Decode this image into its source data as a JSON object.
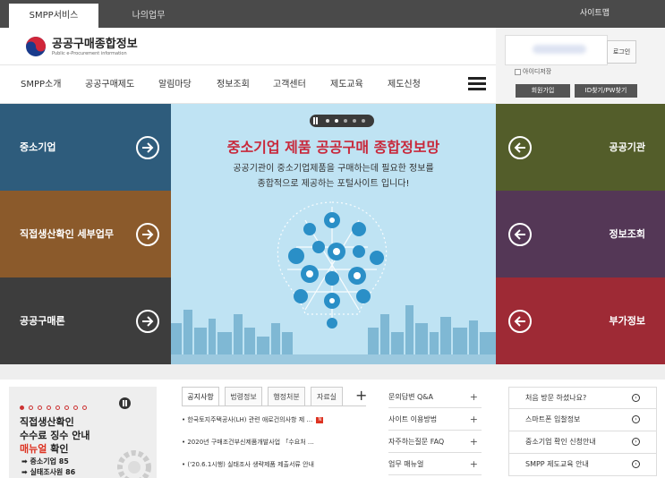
{
  "top_tabs": {
    "smpp": "SMPP서비스",
    "my": "나의업무",
    "sitemap": "사이트맵"
  },
  "logo": {
    "main": "공공구매종합정보",
    "sub": "Public e-Procurement information"
  },
  "login": {
    "login_btn": "로그인",
    "save_id": "아이디저장",
    "join_btn": "회원가입",
    "find_btn": "ID찾기/PW찾기"
  },
  "gnb": [
    "SMPP소개",
    "공공구매제도",
    "알림마당",
    "정보조회",
    "고객센터",
    "제도교육",
    "제도신청"
  ],
  "left_menu": [
    "중소기업",
    "직접생산확인 세부업무",
    "공공구매론"
  ],
  "right_menu": [
    "공공기관",
    "정보조회",
    "부가정보"
  ],
  "colors": {
    "left": [
      "#2e5c7c",
      "#8b5a2b",
      "#3d3d3d"
    ],
    "right": [
      "#535d2a",
      "#543756",
      "#9e2a35"
    ],
    "accent": "#c8283b"
  },
  "banner": {
    "title": "중소기업 제품 공공구매 종합정보망",
    "desc1": "공공기관이 중소기업제품을 구매하는데 필요한 정보를",
    "desc2": "종합적으로 제공하는 포털사이트 입니다!"
  },
  "promo": {
    "line1": "직접생산확인",
    "line2": "수수료 징수 안내",
    "line3_red": "매뉴얼",
    "line3_rest": " 확인",
    "small1": "➡ 중소기업 85",
    "small2": "➡ 실태조사원 86"
  },
  "notice": {
    "tabs": [
      "공지사항",
      "법령정보",
      "행정처분",
      "자료실"
    ],
    "plus": "+",
    "new_badge": "N",
    "items": [
      "• 한국토지주택공사(LH) 관련 애로건의사항 제 …",
      "• 2020년 구매조건부신제품개발사업 「수요처 …",
      "• ('20.6.1시행) 실태조사 생략제품 제출서류 안내"
    ]
  },
  "faq": [
    {
      "label": "문의답변 Q&A",
      "plus": "+"
    },
    {
      "label": "사이트 이용방법",
      "plus": "+"
    },
    {
      "label": "자주하는질문 FAQ",
      "plus": "+"
    },
    {
      "label": "업무 매뉴얼",
      "plus": "+"
    }
  ],
  "right_links": [
    {
      "label": "처음 방문 하셨나요?",
      "go": "›"
    },
    {
      "label": "스마트폰 입찰정보",
      "go": "›"
    },
    {
      "label": "중소기업 확인 신청안내",
      "go": "›"
    },
    {
      "label": "SMPP 제도교육 안내",
      "go": "›"
    }
  ]
}
